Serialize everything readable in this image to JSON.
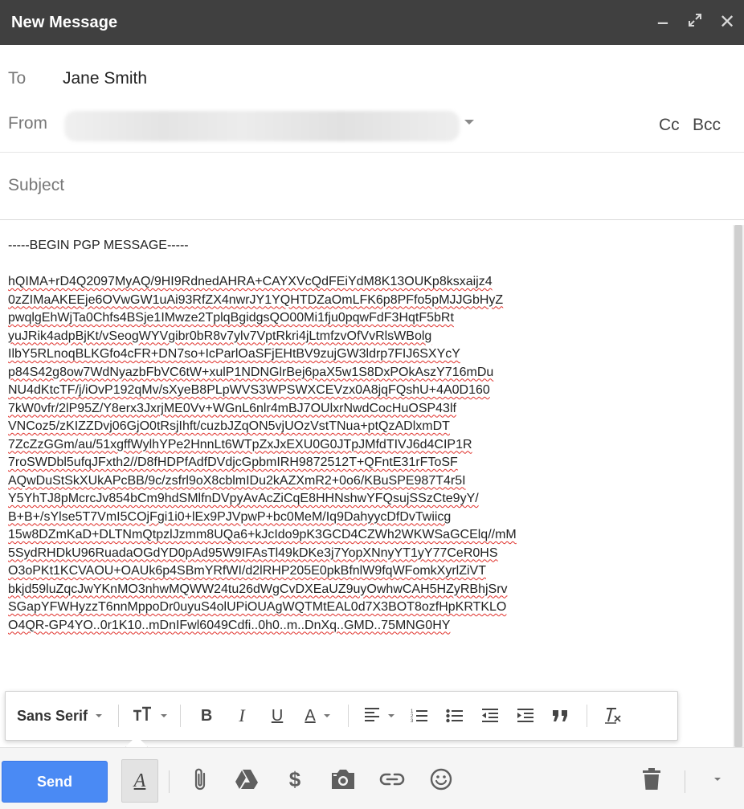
{
  "window": {
    "title": "New Message",
    "minimize_icon": "minimize-icon",
    "popout_icon": "expand-icon",
    "close_icon": "close-icon"
  },
  "recipients": {
    "to_label": "To",
    "to_value": "Jane Smith",
    "from_label": "From",
    "cc_label": "Cc",
    "bcc_label": "Bcc"
  },
  "subject": {
    "placeholder": "Subject",
    "value": ""
  },
  "body": {
    "header_line": "-----BEGIN PGP MESSAGE-----",
    "lines": [
      "hQIMA+rD4Q2097MyAQ/9HI9RdnedAHRA+CAYXVcQdFEiYdM8K13OUKp8ksxaijz4",
      "0zZIMaAKEEje6OVwGW1uAi93RfZX4nwrJY1YQHTDZaOmLFK6p8PFfo5pMJJGbHyZ",
      "pwqlgEhWjTa0Chfs4BSje1IMwze2TplqBgidgsQO00Mi1fju0pqwFdF3HqtF5bRt",
      "yuJRik4adpBjKt/vSeogWYVgibr0bR8v7ylv7VptRkri4jLtmfzvOfVvRlsWBolg",
      "IlbY5RLnoqBLKGfo4cFR+DN7so+IcParlOaSFjEHtBV9zujGW3ldrp7FIJ6SXYcY",
      "p84S42g8ow7WdNyazbFbVC6tW+xulP1NDNGlrBej6paX5w1S8DxPOkAszY716mDu",
      "NU4dKtcTF/j/iOvP192qMv/sXyeB8PLpWVS3WPSWXCEVzx0A8jqFQshU+4A0D160",
      "7kW0vfr/2lP95Z/Y8erx3JxrjME0Vv+WGnL6nlr4mBJ7OUlxrNwdCocHuOSP43lf",
      "VNCoz5/zKIZZDvj06GjO0tRsjIhft/cuzbJZqON5vjUOzVstTNua+ptQzADlxmDT",
      "7ZcZzGGm/au/51xgffWylhYPe2HnnLt6WTpZxJxEXU0G0JTpJMfdTIVJ6d4CIP1R",
      "7roSWDbl5ufqJFxth2//D8fHDPfAdfDVdjcGpbmIRH9872512T+QFntE31rFToSF",
      "AQwDuStSkXUkAPcBB/9c/zsfrl9oX8cblmIDu2kAZXmR2+0o6/KBuSPE987T4r5I",
      "Y5YhTJ8pMcrcJv854bCm9hdSMlfnDVpyAvAcZiCqE8HHNshwYFQsujSSzCte9yY/",
      "B+B+/sYlse5T7VmI5COjFgi1i0+lEx9PJVpwP+bc0MeM/Iq9DahyycDfDvTwiicg",
      "15w8DZmKaD+DLTNmQtpzlJzmm8UQa6+kJcIdo9pK3GCD4CZWh2WKWSaGCElq//mM",
      "5SydRHDkU96RuadaOGdYD0pAd95W9IFAsTl49kDKe3j7YopXNnyYT1yY77CeR0HS",
      "O3oPKt1KCVAOU+OAUk6p4SBmYRfWI/d2lRHP205E0pkBfnlW9fqWFomkXyrlZiVT",
      "bkjd59luZqcJwYKnMO3nhwMQWW24tu26dWgCvDXEaUZ9uyOwhwCAH5HZyRBhjSrv",
      "SGapYFWHyzzT6nnMppoDr0uyuS4olUPiOUAgWQTMtEAL0d7X3BOT8ozfHpKRTKLO"
    ],
    "partial_line": "O4QR-GP4YO..0r1K10..mDnIFwl6049Cdfi..0h0..m..DnXq..GMD..75MNG0HY"
  },
  "format_toolbar": {
    "font_family": "Sans Serif",
    "size_icon": "text-size-icon",
    "bold_label": "B",
    "italic_label": "I",
    "underline_label": "U",
    "text_color_label": "A",
    "icons": [
      "text-size-icon",
      "bold-icon",
      "italic-icon",
      "underline-icon",
      "text-color-icon",
      "align-icon",
      "numbered-list-icon",
      "bulleted-list-icon",
      "indent-less-icon",
      "indent-more-icon",
      "quote-icon",
      "remove-formatting-icon"
    ]
  },
  "bottom_bar": {
    "send_label": "Send",
    "format_toggle_label": "A",
    "dollar_symbol": "$",
    "icons": [
      "attach-icon",
      "drive-icon",
      "money-icon",
      "photo-icon",
      "link-icon",
      "emoji-icon",
      "trash-icon",
      "more-options-icon"
    ]
  },
  "colors": {
    "titlebar_bg": "#404040",
    "send_button": "#4a8af4",
    "spellcheck_underline": "#e0302a"
  }
}
